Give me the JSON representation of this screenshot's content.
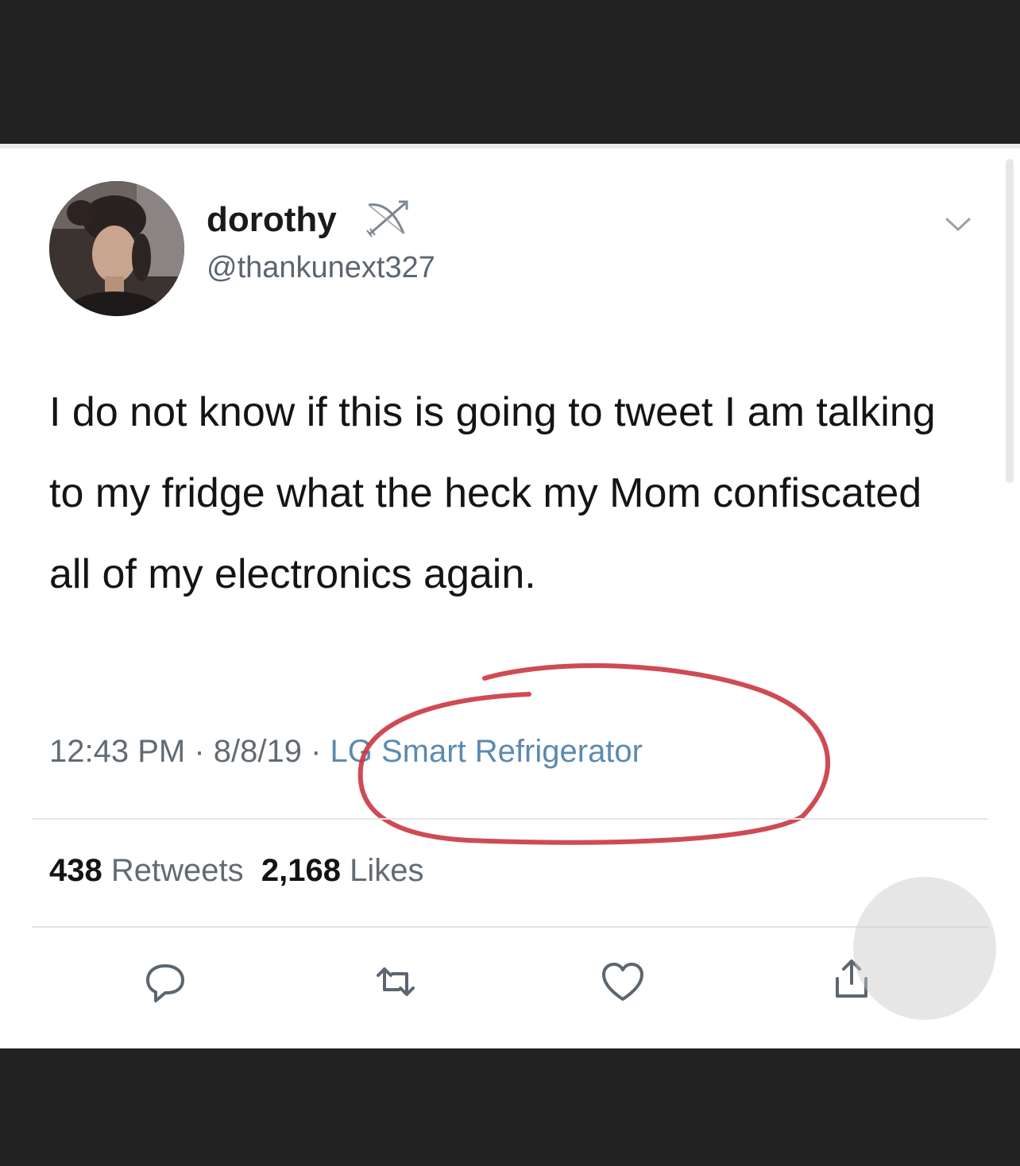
{
  "tweet": {
    "display_name": "dorothy",
    "handle": "@thankunext327",
    "text": "I do not know if this is going to tweet I am talking to my fridge what the heck my Mom confiscated all of my electronics again.",
    "time": "12:43 PM",
    "date": "8/8/19",
    "source": "LG Smart Refrigerator",
    "separator": " · ",
    "retweets_count": "438",
    "retweets_label": "Retweets",
    "likes_count": "2,168",
    "likes_label": "Likes"
  },
  "icons": {
    "name_emoji": "bow-and-arrow-icon",
    "menu": "chevron-down-icon",
    "reply": "reply-icon",
    "retweet": "retweet-icon",
    "like": "heart-icon",
    "share": "share-icon"
  },
  "colors": {
    "source_link": "#5c8ab0",
    "annotation": "#c8323c",
    "icon_gray": "#5b6670"
  }
}
